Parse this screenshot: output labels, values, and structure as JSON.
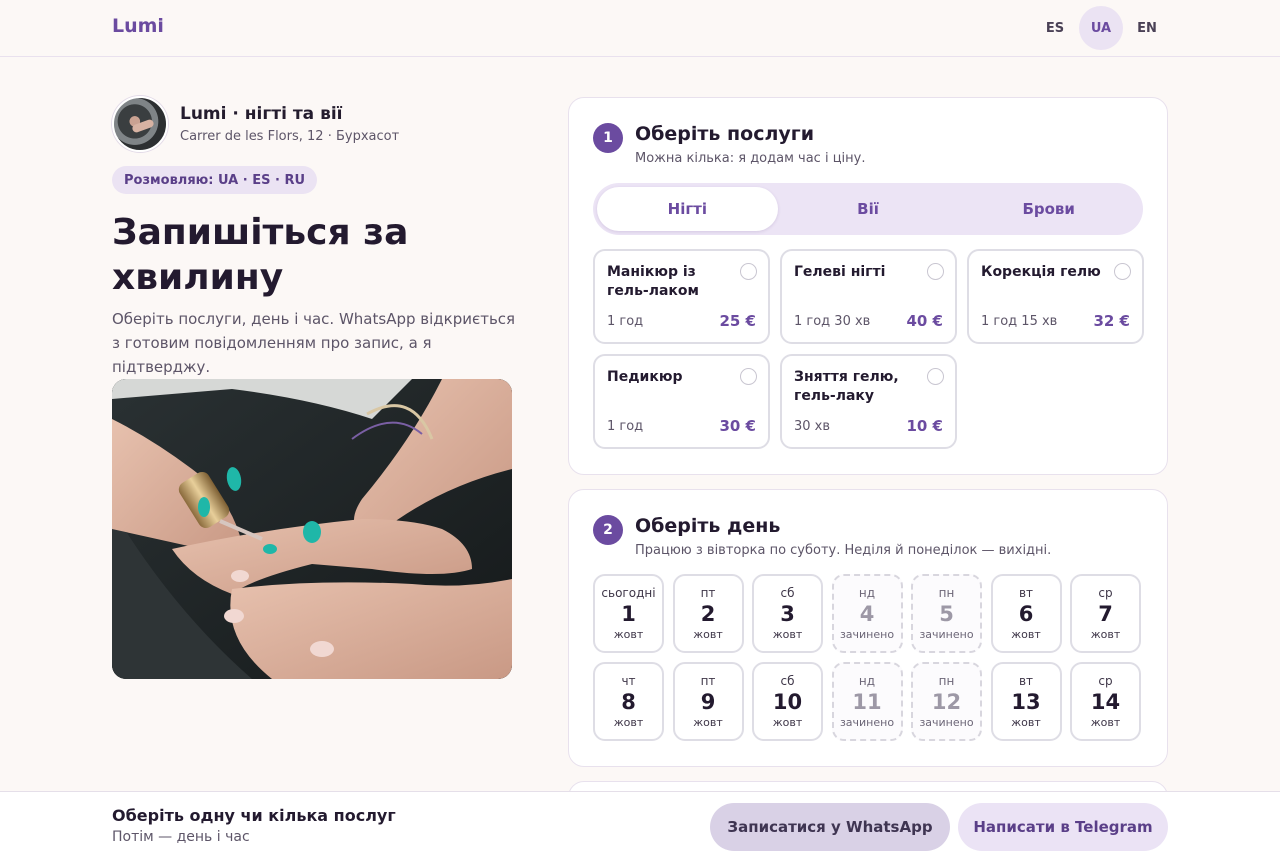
{
  "header": {
    "logo": "Lumi",
    "languages": [
      {
        "code": "ES",
        "active": false
      },
      {
        "code": "UA",
        "active": true
      },
      {
        "code": "EN",
        "active": false
      }
    ]
  },
  "profile": {
    "name": "Lumi · нігті та вії",
    "address": "Carrer de les Flors, 12 · Бурхасот",
    "languages_badge": "Розмовляю: UA · ES · RU"
  },
  "hero": {
    "title": "Запишіться за хвилину",
    "subtitle": "Оберіть послуги, день і час. WhatsApp відкриється з готовим повідомленням про запис, а я підтверджу."
  },
  "step1": {
    "number": "1",
    "title": "Оберіть послуги",
    "subtitle": "Можна кілька: я додам час і ціну.",
    "tabs": [
      {
        "label": "Нігті",
        "active": true
      },
      {
        "label": "Вії",
        "active": false
      },
      {
        "label": "Брови",
        "active": false
      }
    ],
    "services": [
      {
        "name": "Манікюр із гель-лаком",
        "duration": "1 год",
        "price": "25 €"
      },
      {
        "name": "Гелеві нігті",
        "duration": "1 год 30 хв",
        "price": "40 €"
      },
      {
        "name": "Корекція гелю",
        "duration": "1 год 15 хв",
        "price": "32 €"
      },
      {
        "name": "Педикюр",
        "duration": "1 год",
        "price": "30 €"
      },
      {
        "name": "Зняття гелю, гель-лаку",
        "duration": "30 хв",
        "price": "10 €"
      }
    ]
  },
  "step2": {
    "number": "2",
    "title": "Оберіть день",
    "subtitle": "Працюю з вівторка по суботу. Неділя й понеділок — вихідні.",
    "days": [
      {
        "weekday": "сьогодні",
        "num": "1",
        "month": "жовт",
        "closed": false
      },
      {
        "weekday": "пт",
        "num": "2",
        "month": "жовт",
        "closed": false
      },
      {
        "weekday": "сб",
        "num": "3",
        "month": "жовт",
        "closed": false
      },
      {
        "weekday": "нд",
        "num": "4",
        "month": "зачинено",
        "closed": true
      },
      {
        "weekday": "пн",
        "num": "5",
        "month": "зачинено",
        "closed": true
      },
      {
        "weekday": "вт",
        "num": "6",
        "month": "жовт",
        "closed": false
      },
      {
        "weekday": "ср",
        "num": "7",
        "month": "жовт",
        "closed": false
      },
      {
        "weekday": "чт",
        "num": "8",
        "month": "жовт",
        "closed": false
      },
      {
        "weekday": "пт",
        "num": "9",
        "month": "жовт",
        "closed": false
      },
      {
        "weekday": "сб",
        "num": "10",
        "month": "жовт",
        "closed": false
      },
      {
        "weekday": "нд",
        "num": "11",
        "month": "зачинено",
        "closed": true
      },
      {
        "weekday": "пн",
        "num": "12",
        "month": "зачинено",
        "closed": true
      },
      {
        "weekday": "вт",
        "num": "13",
        "month": "жовт",
        "closed": false
      },
      {
        "weekday": "ср",
        "num": "14",
        "month": "жовт",
        "closed": false
      }
    ]
  },
  "bottom_bar": {
    "title": "Оберіть одну чи кілька послуг",
    "subtitle": "Потім — день і час",
    "whatsapp_label": "Записатися у WhatsApp",
    "telegram_label": "Написати в Telegram"
  },
  "colors": {
    "accent": "#6b4ba0",
    "accent_soft": "#ebe3f3",
    "background": "#fcf8f6"
  }
}
